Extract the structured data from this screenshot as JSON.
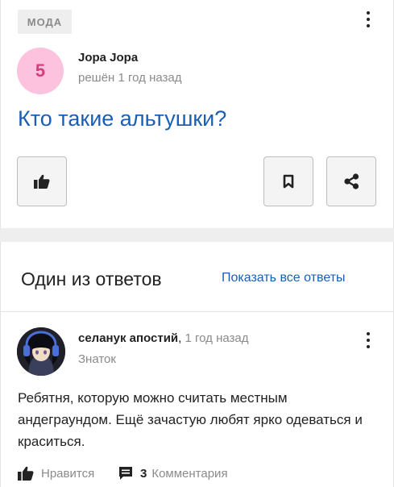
{
  "question": {
    "category": "МОДА",
    "rank_number": "5",
    "author": "Jopa Jopa",
    "status_time": "решён 1 год назад",
    "title": "Кто такие альтушки?",
    "buttons": {
      "like": "thumbs-up-icon",
      "bookmark": "bookmark-icon",
      "share": "share-icon"
    }
  },
  "answers_section": {
    "title": "Один из ответов",
    "show_all_link": "Показать все ответы"
  },
  "answer": {
    "author": "селанук апостий",
    "separator": ",",
    "time": "1 год назад",
    "rank": "Знаток",
    "text": "Ребятня, которую можно считать местным андеграундом. Ещё зачастую любят ярко одеваться и краситься.",
    "actions": {
      "like_label": "Нравится",
      "comments_count": "3",
      "comments_label": "Комментария"
    }
  },
  "colors": {
    "accent_link": "#1a5fb4",
    "rank_badge_bg": "#fcc2de",
    "rank_badge_text": "#d63e77",
    "muted_text": "#8b8b8b"
  }
}
